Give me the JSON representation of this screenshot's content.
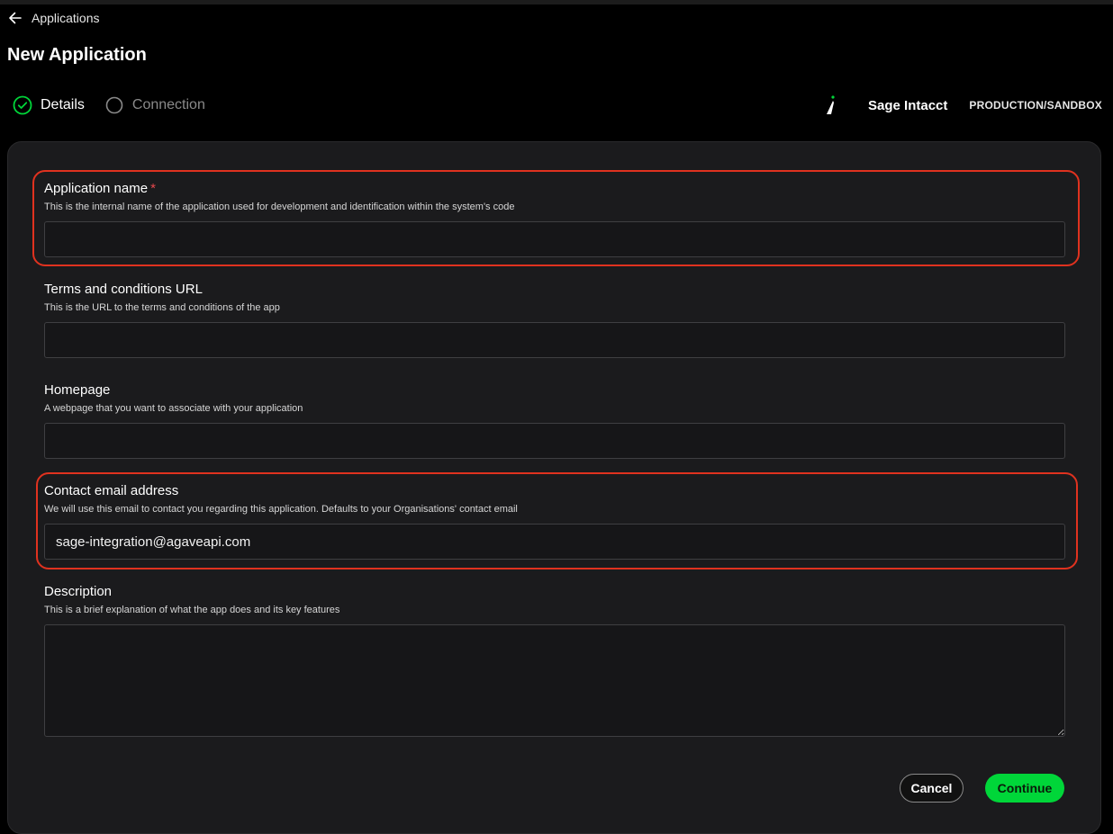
{
  "nav": {
    "back_label": "Applications"
  },
  "page": {
    "title": "New Application"
  },
  "steps": [
    {
      "label": "Details",
      "state": "completed"
    },
    {
      "label": "Connection",
      "state": "pending"
    }
  ],
  "brand": {
    "name": "Sage Intacct",
    "environment": "PRODUCTION/SANDBOX"
  },
  "form": {
    "application_name": {
      "label": "Application name",
      "required_marker": "*",
      "help": "This is the internal name of the application used for development and identification within the system's code",
      "value": ""
    },
    "terms_url": {
      "label": "Terms and conditions URL",
      "help": "This is the URL to the terms and conditions of the app",
      "value": ""
    },
    "homepage": {
      "label": "Homepage",
      "help": "A webpage that you want to associate with your application",
      "value": ""
    },
    "contact_email": {
      "label": "Contact email address",
      "help": "We will use this email to contact you regarding this application. Defaults to your Organisations' contact email",
      "value": "sage-integration@agaveapi.com"
    },
    "description": {
      "label": "Description",
      "help": "This is a brief explanation of what the app does and its key features",
      "value": ""
    }
  },
  "actions": {
    "cancel_label": "Cancel",
    "continue_label": "Continue"
  },
  "colors": {
    "accent_green": "#00d639",
    "highlight_red": "#e0321f",
    "required_red": "#e5484d",
    "card_background": "#1b1b1d"
  }
}
